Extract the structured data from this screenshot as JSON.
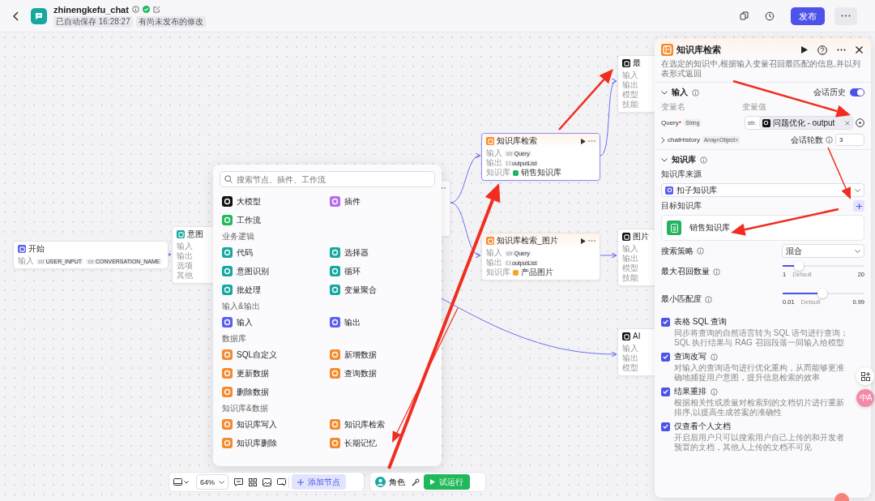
{
  "header": {
    "title": "zhinengkefu_chat",
    "status_tags": [
      "已自动保存 16:28:27",
      "有尚未发布的修改"
    ],
    "publish": "发布"
  },
  "canvas": {
    "nodes": [
      {
        "kind": "start",
        "title": "开始",
        "rows": [
          {
            "label": "输入",
            "tags": [
              {
                "kind": "typed",
                "type": "str",
                "name": "USER_INPUT"
              },
              {
                "kind": "typed",
                "type": "str",
                "name": "CONVERSATION_NAME"
              }
            ]
          }
        ]
      },
      {
        "kind": "intent",
        "title": "意图",
        "rows": [
          {
            "label": "输入"
          },
          {
            "label": "输出"
          },
          {
            "label": "选项"
          },
          {
            "label": "其他"
          }
        ]
      },
      {
        "kind": "covered"
      },
      {
        "kind": "kb",
        "title": "知识库检索",
        "selected": true,
        "rows": [
          {
            "label": "输入",
            "tags": [
              {
                "kind": "typed",
                "type": "str",
                "name": "Query"
              }
            ]
          },
          {
            "label": "输出",
            "tags": [
              {
                "kind": "list",
                "name": "outputList"
              }
            ]
          },
          {
            "label": "知识库",
            "kb": "销售知识库",
            "color": "#22b35e"
          }
        ]
      },
      {
        "kind": "kb",
        "title": "知识库检索_图片",
        "selected": false,
        "rows": [
          {
            "label": "输入",
            "tags": [
              {
                "kind": "typed",
                "type": "str",
                "name": "Query"
              }
            ]
          },
          {
            "label": "输出",
            "tags": [
              {
                "kind": "list",
                "name": "outputList"
              }
            ]
          },
          {
            "label": "知识库",
            "kb": "产品图片",
            "color": "#f5a623"
          }
        ]
      },
      {
        "kind": "llm",
        "title": "最",
        "rows": [
          {
            "label": "输入"
          },
          {
            "label": "输出"
          },
          {
            "label": "模型"
          },
          {
            "label": "技能"
          }
        ]
      },
      {
        "kind": "llm",
        "title": "图片",
        "rows": [
          {
            "label": "输入"
          },
          {
            "label": "输出"
          },
          {
            "label": "模型"
          },
          {
            "label": "技能"
          }
        ]
      },
      {
        "kind": "llm",
        "title": "AI",
        "rows": [
          {
            "label": "输入"
          },
          {
            "label": "输出"
          },
          {
            "label": "模型"
          }
        ]
      }
    ]
  },
  "add_menu": {
    "search_placeholder": "搜索节点、插件、工作流",
    "sections": [
      {
        "items": [
          {
            "label": "大模型",
            "kind": "llm"
          },
          {
            "label": "插件",
            "kind": "plugin"
          },
          {
            "label": "工作流",
            "kind": "workflow"
          }
        ]
      },
      {
        "heading": "业务逻辑",
        "items": [
          {
            "label": "代码",
            "kind": "logic"
          },
          {
            "label": "选择器",
            "kind": "logic"
          },
          {
            "label": "意图识别",
            "kind": "logic"
          },
          {
            "label": "循环",
            "kind": "logic"
          },
          {
            "label": "批处理",
            "kind": "logic"
          },
          {
            "label": "变量聚合",
            "kind": "logic"
          }
        ]
      },
      {
        "heading": "输入&输出",
        "items": [
          {
            "label": "输入",
            "kind": "io"
          },
          {
            "label": "输出",
            "kind": "io"
          }
        ]
      },
      {
        "heading": "数据库",
        "items": [
          {
            "label": "SQL自定义",
            "kind": "db"
          },
          {
            "label": "新增数据",
            "kind": "db"
          },
          {
            "label": "更新数据",
            "kind": "db"
          },
          {
            "label": "查询数据",
            "kind": "db"
          },
          {
            "label": "删除数据",
            "kind": "db"
          }
        ]
      },
      {
        "heading": "知识库&数据",
        "items": [
          {
            "label": "知识库写入",
            "kind": "kb"
          },
          {
            "label": "知识库检索",
            "kind": "kb"
          },
          {
            "label": "知识库删除",
            "kind": "kb"
          },
          {
            "label": "长期记忆",
            "kind": "kb"
          }
        ]
      }
    ]
  },
  "toolbar": {
    "zoom": "64%",
    "add_node": "添加节点",
    "role": "角色",
    "test_run": "试运行"
  },
  "panel": {
    "title": "知识库检索",
    "description": "在选定的知识中,根据输入变量召回最匹配的信息,并以列表形式返回",
    "input": {
      "heading": "输入",
      "history_label": "会话历史",
      "history_on": true,
      "col_name": "变量名",
      "col_value": "变量值",
      "query": {
        "name": "Query",
        "required_mark": "*",
        "type": "String",
        "value_type": "str.",
        "value": "问题优化 - output"
      },
      "chat_history": {
        "name": "chatHistory",
        "type": "Array<Object>",
        "expanded": false,
        "rounds_label": "会话轮数",
        "rounds": "3"
      }
    },
    "knowledge": {
      "heading": "知识库",
      "source_label": "知识库来源",
      "source": "扣子知识库",
      "target_label": "目标知识库",
      "targets": [
        "销售知识库"
      ],
      "strategy_label": "搜索策略",
      "strategy": "混合",
      "sliders": [
        {
          "label": "最大召回数量",
          "level": 0.2,
          "min": "1",
          "default": "Default",
          "max": "20"
        },
        {
          "label": "最小匹配度",
          "level": 0.49,
          "min": "0.01",
          "default": "Default",
          "max": "0.99"
        }
      ],
      "options": [
        {
          "label": "表格 SQL 查询",
          "info": false,
          "checked": true,
          "description": "同步将查询的自然语言转为 SQL 语句进行查询；SQL 执行结果与 RAG 召回段落一同输入给模型"
        },
        {
          "label": "查询改写",
          "info": true,
          "checked": true,
          "description": "对输入的查询语句进行优化重构，从而能够更准确地捕捉用户意图，提升信息检索的效率"
        },
        {
          "label": "结果重排",
          "info": true,
          "checked": true,
          "description": "根据相关性或质量对检索到的文档切片进行重新排序,以提高生成答案的准确性"
        },
        {
          "label": "仅查看个人文档",
          "info": false,
          "checked": true,
          "description": "开启后用户只可以搜索用户自己上传的和开发者预置的文档，其他人上传的文档不可见"
        }
      ]
    }
  },
  "floating": {
    "translate": "中A"
  }
}
